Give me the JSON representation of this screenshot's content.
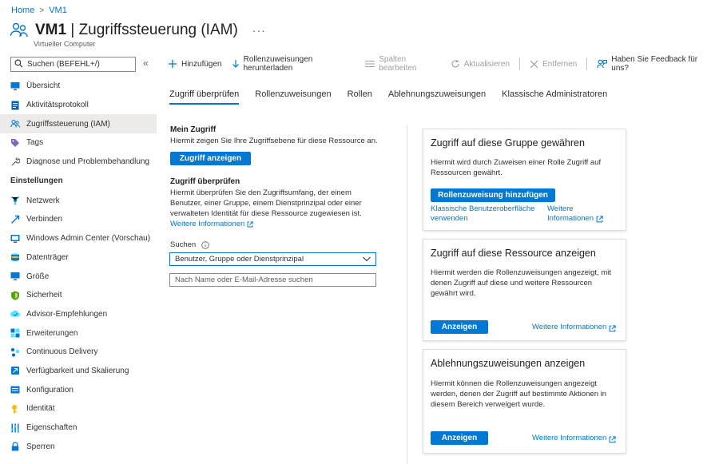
{
  "breadcrumb": [
    "Home",
    "VM1"
  ],
  "header": {
    "title_bold": "VM1",
    "title_rest": " | Zugriffssteuerung (IAM)",
    "more": "···",
    "subtitle": "Virtueller Computer"
  },
  "sidebar": {
    "search_placeholder": "Suchen (BEFEHL+/)",
    "collapse": "«",
    "items_top": [
      {
        "label": "Übersicht",
        "icon": "monitor-icon"
      },
      {
        "label": "Aktivitätsprotokoll",
        "icon": "log-icon"
      },
      {
        "label": "Zugriffssteuerung (IAM)",
        "icon": "people-icon",
        "active": true
      },
      {
        "label": "Tags",
        "icon": "tag-icon"
      },
      {
        "label": "Diagnose und Problembehandlung",
        "icon": "wrench-icon"
      }
    ],
    "section": "Einstellungen",
    "items_settings": [
      {
        "label": "Netzwerk",
        "icon": "network-icon"
      },
      {
        "label": "Verbinden",
        "icon": "connect-icon"
      },
      {
        "label": "Windows Admin Center (Vorschau)",
        "icon": "admin-center-icon"
      },
      {
        "label": "Datenträger",
        "icon": "disk-icon"
      },
      {
        "label": "Größe",
        "icon": "size-icon"
      },
      {
        "label": "Sicherheit",
        "icon": "shield-icon"
      },
      {
        "label": "Advisor-Empfehlungen",
        "icon": "advisor-icon"
      },
      {
        "label": "Erweiterungen",
        "icon": "extensions-icon"
      },
      {
        "label": "Continuous Delivery",
        "icon": "delivery-icon"
      },
      {
        "label": "Verfügbarkeit und Skalierung",
        "icon": "scale-icon"
      },
      {
        "label": "Konfiguration",
        "icon": "config-icon"
      },
      {
        "label": "Identität",
        "icon": "identity-icon"
      },
      {
        "label": "Eigenschaften",
        "icon": "properties-icon"
      },
      {
        "label": "Sperren",
        "icon": "lock-icon"
      }
    ]
  },
  "toolbar": {
    "add": "Hinzufügen",
    "download": "Rollenzuweisungen herunterladen",
    "columns": "Spalten bearbeiten",
    "refresh": "Aktualisieren",
    "remove": "Entfernen",
    "feedback": "Haben Sie Feedback für uns?"
  },
  "tabs": [
    "Zugriff überprüfen",
    "Rollenzuweisungen",
    "Rollen",
    "Ablehnungszuweisungen",
    "Klassische Administratoren"
  ],
  "my_access": {
    "title": "Mein Zugriff",
    "text": "Hiermit zeigen Sie Ihre Zugriffsebene für diese Ressource an.",
    "button": "Zugriff anzeigen"
  },
  "check_access": {
    "title": "Zugriff überprüfen",
    "text_lines": [
      "Hiermit überprüfen Sie den Zugriffsumfang, der einem",
      "Benutzer, einer Gruppe, einem Dienstprinzipal oder einer",
      "verwalteten Identität für diese Ressource zugewiesen ist."
    ],
    "link": "Weitere Informationen",
    "search_label": "Suchen",
    "select_value": "Benutzer, Gruppe oder Dienstprinzipal",
    "input_placeholder": "Nach Name oder E-Mail-Adresse suchen"
  },
  "cards": {
    "grant": {
      "title": "Zugriff auf diese Gruppe gewähren",
      "text_lines": [
        "Hiermit wird durch Zuweisen einer Rolle Zugriff auf",
        "Ressourcen gewährt."
      ],
      "button": "Rollenzuweisung hinzufügen",
      "link_classic_1": "Klassische Benutzeroberfläche",
      "link_classic_2": "verwenden",
      "link_more_1": "Weitere",
      "link_more_2": "Informationen"
    },
    "view": {
      "title": "Zugriff auf diese Ressource anzeigen",
      "text_lines": [
        "Hiermit werden die Rollenzuweisungen angezeigt, mit",
        "denen Zugriff auf diese und weitere Ressourcen",
        "gewährt wird."
      ],
      "button": "Anzeigen",
      "link": "Weitere Informationen"
    },
    "deny": {
      "title": "Ablehnungszuweisungen anzeigen",
      "text_lines": [
        "Hiermit können die Rollenzuweisungen angezeigt",
        "werden, denen der Zugriff auf bestimmte Aktionen in",
        "diesem Bereich verweigert wurde."
      ],
      "button": "Anzeigen",
      "link": "Weitere Informationen"
    }
  },
  "colors": {
    "accent": "#0078d4",
    "active_nav": "#edebe9",
    "border": "#e1dfdd"
  }
}
